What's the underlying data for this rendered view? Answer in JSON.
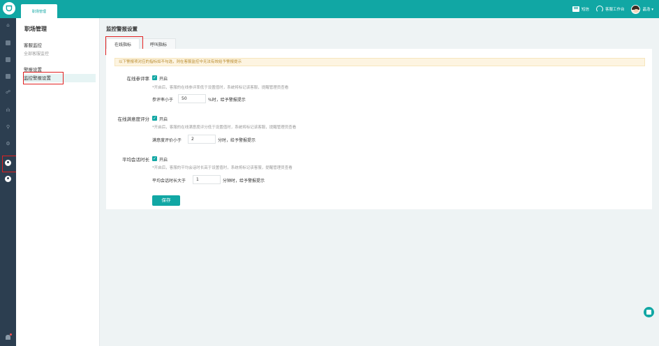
{
  "topbar": {
    "tab_label": "职场管理",
    "sms_label": "短信",
    "workbench_label": "客服工作台",
    "user_label": "晶浩 ▾"
  },
  "submenu": {
    "title": "职场管理",
    "group1": "客服监控",
    "item1": "全部客服监控",
    "group2": "警报设置",
    "item2": "监控警报设置"
  },
  "main": {
    "title": "监控警报设置",
    "tabs": [
      "在线指标",
      "呼叫指标"
    ],
    "warning": "以下警报项对应的指标如不勾选，则在客服监控中无法有效给予警报提示",
    "rows": [
      {
        "label": "在线参评率",
        "checkbox": "开启",
        "hint": "*开启后，客服的在线参评率低于设置值时，系统将标记该客服，提醒管理员查看",
        "prefix": "参评率小于",
        "value": "50",
        "suffix": "%时，给予警报提示"
      },
      {
        "label": "在线满意度评分",
        "checkbox": "开启",
        "hint": "*开启后，客服的在线满意度评分低于设置值时，系统将标记该客服，提醒管理员查看",
        "prefix": "满意度评价小于",
        "value": "2",
        "suffix": "分时，给予警报提示"
      },
      {
        "label": "平均会话时长",
        "checkbox": "开启",
        "hint": "*开启后，客服的平均会话时长高于设置值时，系统将标记该客服，提醒管理员查看",
        "prefix": "平均会话时长大于",
        "value": "1",
        "suffix": "分钟时，给予警报提示"
      }
    ],
    "save_label": "保存"
  },
  "colors": {
    "accent": "#11a7a4",
    "iconbar_bg": "#2c3e50",
    "highlight_box": "#e02020"
  }
}
